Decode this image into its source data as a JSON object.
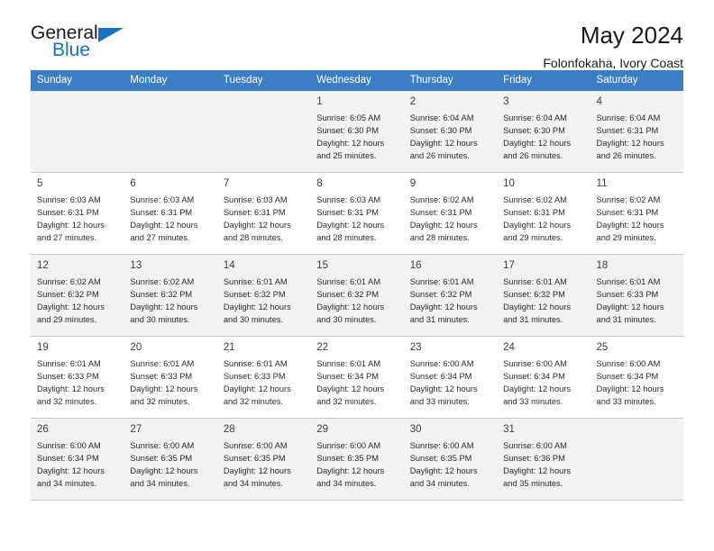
{
  "brand": {
    "name_top": "General",
    "name_bottom": "Blue",
    "accent_color": "#1673c4"
  },
  "header": {
    "title": "May 2024",
    "subtitle": "Folonfokaha, Ivory Coast"
  },
  "theme": {
    "header_row_bg": "#3b7ec4",
    "header_row_text": "#ffffff",
    "shaded_cell_bg": "#f2f2f2",
    "grid_line": "#c9c9c9"
  },
  "weekday_headers": [
    "Sunday",
    "Monday",
    "Tuesday",
    "Wednesday",
    "Thursday",
    "Friday",
    "Saturday"
  ],
  "labels": {
    "sunrise_prefix": "Sunrise:",
    "sunset_prefix": "Sunset:",
    "daylight_prefix": "Daylight:"
  },
  "weeks": [
    [
      {
        "day": "",
        "sunrise": "",
        "sunset": "",
        "daylight_line1": "",
        "daylight_line2": "",
        "empty": true,
        "shaded": true
      },
      {
        "day": "",
        "sunrise": "",
        "sunset": "",
        "daylight_line1": "",
        "daylight_line2": "",
        "empty": true,
        "shaded": true
      },
      {
        "day": "",
        "sunrise": "",
        "sunset": "",
        "daylight_line1": "",
        "daylight_line2": "",
        "empty": true,
        "shaded": true
      },
      {
        "day": "1",
        "sunrise": "Sunrise: 6:05 AM",
        "sunset": "Sunset: 6:30 PM",
        "daylight_line1": "Daylight: 12 hours",
        "daylight_line2": "and 25 minutes.",
        "empty": false,
        "shaded": true
      },
      {
        "day": "2",
        "sunrise": "Sunrise: 6:04 AM",
        "sunset": "Sunset: 6:30 PM",
        "daylight_line1": "Daylight: 12 hours",
        "daylight_line2": "and 26 minutes.",
        "empty": false,
        "shaded": true
      },
      {
        "day": "3",
        "sunrise": "Sunrise: 6:04 AM",
        "sunset": "Sunset: 6:30 PM",
        "daylight_line1": "Daylight: 12 hours",
        "daylight_line2": "and 26 minutes.",
        "empty": false,
        "shaded": true
      },
      {
        "day": "4",
        "sunrise": "Sunrise: 6:04 AM",
        "sunset": "Sunset: 6:31 PM",
        "daylight_line1": "Daylight: 12 hours",
        "daylight_line2": "and 26 minutes.",
        "empty": false,
        "shaded": true
      }
    ],
    [
      {
        "day": "5",
        "sunrise": "Sunrise: 6:03 AM",
        "sunset": "Sunset: 6:31 PM",
        "daylight_line1": "Daylight: 12 hours",
        "daylight_line2": "and 27 minutes.",
        "empty": false,
        "shaded": false
      },
      {
        "day": "6",
        "sunrise": "Sunrise: 6:03 AM",
        "sunset": "Sunset: 6:31 PM",
        "daylight_line1": "Daylight: 12 hours",
        "daylight_line2": "and 27 minutes.",
        "empty": false,
        "shaded": false
      },
      {
        "day": "7",
        "sunrise": "Sunrise: 6:03 AM",
        "sunset": "Sunset: 6:31 PM",
        "daylight_line1": "Daylight: 12 hours",
        "daylight_line2": "and 28 minutes.",
        "empty": false,
        "shaded": false
      },
      {
        "day": "8",
        "sunrise": "Sunrise: 6:03 AM",
        "sunset": "Sunset: 6:31 PM",
        "daylight_line1": "Daylight: 12 hours",
        "daylight_line2": "and 28 minutes.",
        "empty": false,
        "shaded": false
      },
      {
        "day": "9",
        "sunrise": "Sunrise: 6:02 AM",
        "sunset": "Sunset: 6:31 PM",
        "daylight_line1": "Daylight: 12 hours",
        "daylight_line2": "and 28 minutes.",
        "empty": false,
        "shaded": false
      },
      {
        "day": "10",
        "sunrise": "Sunrise: 6:02 AM",
        "sunset": "Sunset: 6:31 PM",
        "daylight_line1": "Daylight: 12 hours",
        "daylight_line2": "and 29 minutes.",
        "empty": false,
        "shaded": false
      },
      {
        "day": "11",
        "sunrise": "Sunrise: 6:02 AM",
        "sunset": "Sunset: 6:31 PM",
        "daylight_line1": "Daylight: 12 hours",
        "daylight_line2": "and 29 minutes.",
        "empty": false,
        "shaded": false
      }
    ],
    [
      {
        "day": "12",
        "sunrise": "Sunrise: 6:02 AM",
        "sunset": "Sunset: 6:32 PM",
        "daylight_line1": "Daylight: 12 hours",
        "daylight_line2": "and 29 minutes.",
        "empty": false,
        "shaded": true
      },
      {
        "day": "13",
        "sunrise": "Sunrise: 6:02 AM",
        "sunset": "Sunset: 6:32 PM",
        "daylight_line1": "Daylight: 12 hours",
        "daylight_line2": "and 30 minutes.",
        "empty": false,
        "shaded": true
      },
      {
        "day": "14",
        "sunrise": "Sunrise: 6:01 AM",
        "sunset": "Sunset: 6:32 PM",
        "daylight_line1": "Daylight: 12 hours",
        "daylight_line2": "and 30 minutes.",
        "empty": false,
        "shaded": true
      },
      {
        "day": "15",
        "sunrise": "Sunrise: 6:01 AM",
        "sunset": "Sunset: 6:32 PM",
        "daylight_line1": "Daylight: 12 hours",
        "daylight_line2": "and 30 minutes.",
        "empty": false,
        "shaded": true
      },
      {
        "day": "16",
        "sunrise": "Sunrise: 6:01 AM",
        "sunset": "Sunset: 6:32 PM",
        "daylight_line1": "Daylight: 12 hours",
        "daylight_line2": "and 31 minutes.",
        "empty": false,
        "shaded": true
      },
      {
        "day": "17",
        "sunrise": "Sunrise: 6:01 AM",
        "sunset": "Sunset: 6:32 PM",
        "daylight_line1": "Daylight: 12 hours",
        "daylight_line2": "and 31 minutes.",
        "empty": false,
        "shaded": true
      },
      {
        "day": "18",
        "sunrise": "Sunrise: 6:01 AM",
        "sunset": "Sunset: 6:33 PM",
        "daylight_line1": "Daylight: 12 hours",
        "daylight_line2": "and 31 minutes.",
        "empty": false,
        "shaded": true
      }
    ],
    [
      {
        "day": "19",
        "sunrise": "Sunrise: 6:01 AM",
        "sunset": "Sunset: 6:33 PM",
        "daylight_line1": "Daylight: 12 hours",
        "daylight_line2": "and 32 minutes.",
        "empty": false,
        "shaded": false
      },
      {
        "day": "20",
        "sunrise": "Sunrise: 6:01 AM",
        "sunset": "Sunset: 6:33 PM",
        "daylight_line1": "Daylight: 12 hours",
        "daylight_line2": "and 32 minutes.",
        "empty": false,
        "shaded": false
      },
      {
        "day": "21",
        "sunrise": "Sunrise: 6:01 AM",
        "sunset": "Sunset: 6:33 PM",
        "daylight_line1": "Daylight: 12 hours",
        "daylight_line2": "and 32 minutes.",
        "empty": false,
        "shaded": false
      },
      {
        "day": "22",
        "sunrise": "Sunrise: 6:01 AM",
        "sunset": "Sunset: 6:34 PM",
        "daylight_line1": "Daylight: 12 hours",
        "daylight_line2": "and 32 minutes.",
        "empty": false,
        "shaded": false
      },
      {
        "day": "23",
        "sunrise": "Sunrise: 6:00 AM",
        "sunset": "Sunset: 6:34 PM",
        "daylight_line1": "Daylight: 12 hours",
        "daylight_line2": "and 33 minutes.",
        "empty": false,
        "shaded": false
      },
      {
        "day": "24",
        "sunrise": "Sunrise: 6:00 AM",
        "sunset": "Sunset: 6:34 PM",
        "daylight_line1": "Daylight: 12 hours",
        "daylight_line2": "and 33 minutes.",
        "empty": false,
        "shaded": false
      },
      {
        "day": "25",
        "sunrise": "Sunrise: 6:00 AM",
        "sunset": "Sunset: 6:34 PM",
        "daylight_line1": "Daylight: 12 hours",
        "daylight_line2": "and 33 minutes.",
        "empty": false,
        "shaded": false
      }
    ],
    [
      {
        "day": "26",
        "sunrise": "Sunrise: 6:00 AM",
        "sunset": "Sunset: 6:34 PM",
        "daylight_line1": "Daylight: 12 hours",
        "daylight_line2": "and 34 minutes.",
        "empty": false,
        "shaded": true
      },
      {
        "day": "27",
        "sunrise": "Sunrise: 6:00 AM",
        "sunset": "Sunset: 6:35 PM",
        "daylight_line1": "Daylight: 12 hours",
        "daylight_line2": "and 34 minutes.",
        "empty": false,
        "shaded": true
      },
      {
        "day": "28",
        "sunrise": "Sunrise: 6:00 AM",
        "sunset": "Sunset: 6:35 PM",
        "daylight_line1": "Daylight: 12 hours",
        "daylight_line2": "and 34 minutes.",
        "empty": false,
        "shaded": true
      },
      {
        "day": "29",
        "sunrise": "Sunrise: 6:00 AM",
        "sunset": "Sunset: 6:35 PM",
        "daylight_line1": "Daylight: 12 hours",
        "daylight_line2": "and 34 minutes.",
        "empty": false,
        "shaded": true
      },
      {
        "day": "30",
        "sunrise": "Sunrise: 6:00 AM",
        "sunset": "Sunset: 6:35 PM",
        "daylight_line1": "Daylight: 12 hours",
        "daylight_line2": "and 34 minutes.",
        "empty": false,
        "shaded": true
      },
      {
        "day": "31",
        "sunrise": "Sunrise: 6:00 AM",
        "sunset": "Sunset: 6:36 PM",
        "daylight_line1": "Daylight: 12 hours",
        "daylight_line2": "and 35 minutes.",
        "empty": false,
        "shaded": true
      },
      {
        "day": "",
        "sunrise": "",
        "sunset": "",
        "daylight_line1": "",
        "daylight_line2": "",
        "empty": true,
        "shaded": true
      }
    ]
  ]
}
